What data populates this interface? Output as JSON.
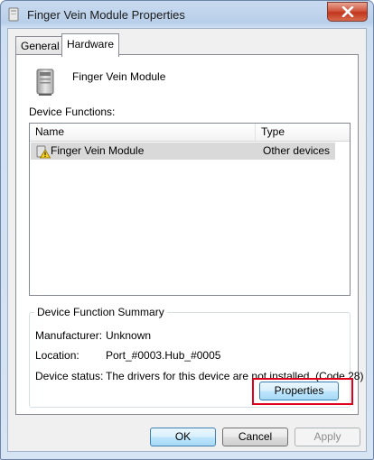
{
  "window": {
    "title": "Finger Vein Module Properties"
  },
  "tabs": [
    {
      "label": "General"
    },
    {
      "label": "Hardware"
    }
  ],
  "hardware": {
    "device_name": "Finger Vein Module",
    "device_functions_label": "Device Functions:",
    "columns": [
      "Name",
      "Type"
    ],
    "rows": [
      {
        "name": "Finger Vein Module",
        "type": "Other devices",
        "status_icon": "warning-icon"
      }
    ],
    "summary": {
      "legend": "Device Function Summary",
      "items": [
        {
          "key": "Manufacturer:",
          "value": "Unknown"
        },
        {
          "key": "Location:",
          "value": "Port_#0003.Hub_#0005"
        },
        {
          "key": "Device status:",
          "value": "The drivers for this device are not installed. (Code 28)"
        }
      ],
      "properties_label": "Properties"
    }
  },
  "footer": {
    "ok": "OK",
    "cancel": "Cancel",
    "apply": "Apply"
  },
  "colors": {
    "highlight": "#e0001b",
    "close_button": "#c2361c",
    "title_bar": "#b9cfe9"
  }
}
